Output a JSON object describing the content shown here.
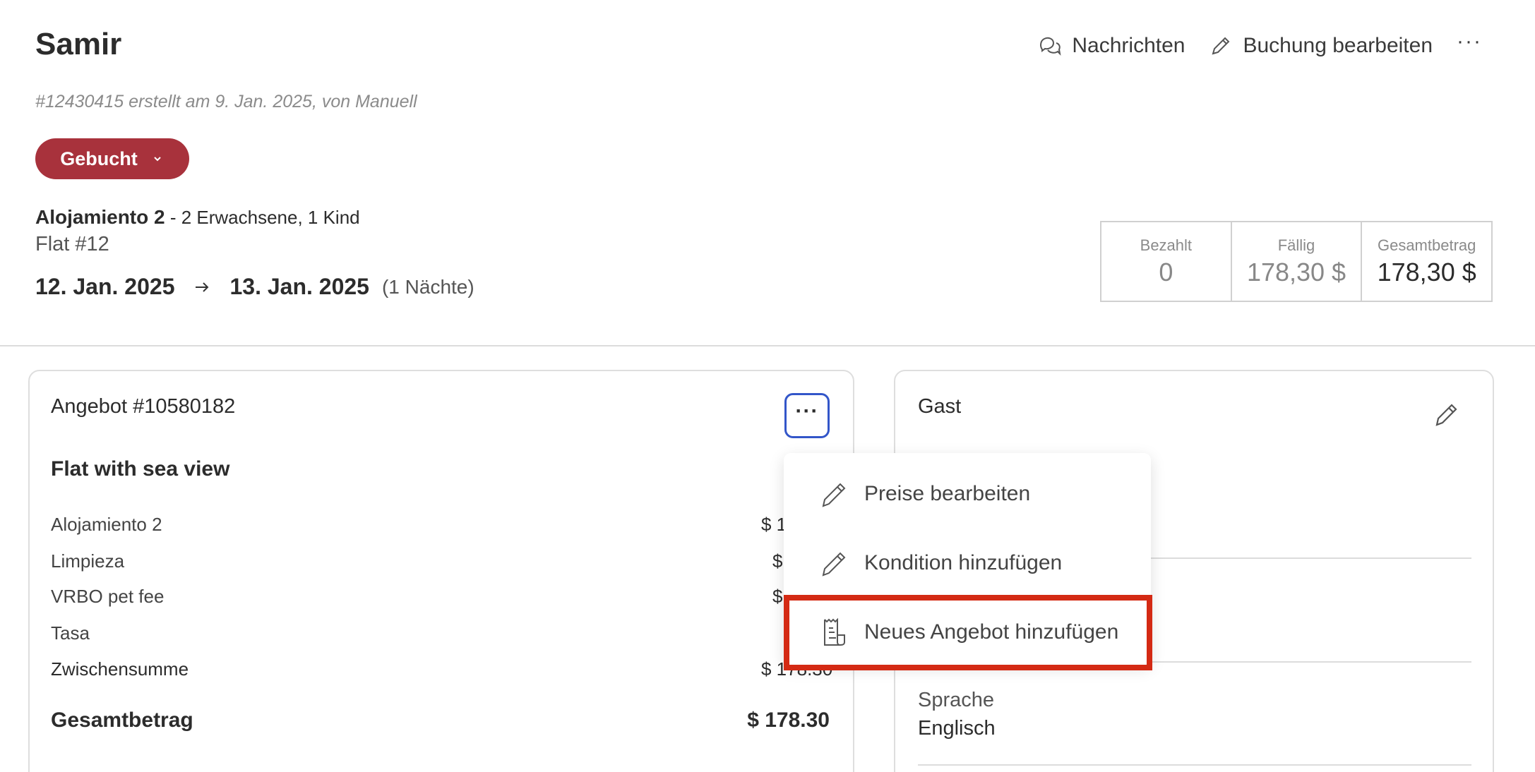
{
  "header": {
    "title": "Samir",
    "actions": {
      "messages_label": "Nachrichten",
      "edit_booking_label": "Buchung bearbeiten",
      "more_label": "···"
    },
    "meta": "#12430415 erstellt am 9. Jan. 2025, von Manuell"
  },
  "status": {
    "label": "Gebucht",
    "color": "#a8323c"
  },
  "booking": {
    "unit": "Alojamiento 2",
    "guests": " - 2 Erwachsene, 1 Kind",
    "flat": "Flat #12",
    "check_in": "12. Jan. 2025",
    "check_out": "13. Jan. 2025",
    "nights": "(1 Nächte)"
  },
  "summary": {
    "paid_label": "Bezahlt",
    "paid_value": "0",
    "due_label": "Fällig",
    "due_value": "178,30 $",
    "total_label": "Gesamtbetrag",
    "total_value": "178,30 $"
  },
  "offer": {
    "title": "Angebot #10580182",
    "more_label": "···",
    "name": "Flat with sea view",
    "lines": [
      {
        "label": "Alojamiento 2",
        "value": "$ 1"
      },
      {
        "label": "Limpieza",
        "value": "$"
      },
      {
        "label": "VRBO pet fee",
        "value": "$"
      },
      {
        "label": "Tasa",
        "value": ""
      },
      {
        "label": "Zwischensumme",
        "value": "$ 178.30"
      }
    ],
    "total_label": "Gesamtbetrag",
    "total_value": "$ 178.30"
  },
  "menu": {
    "items": [
      {
        "label": "Preise bearbeiten",
        "icon": "pencil-icon"
      },
      {
        "label": "Kondition hinzufügen",
        "icon": "pencil-icon"
      },
      {
        "label": "Neues Angebot hinzufügen",
        "icon": "receipt-icon"
      }
    ],
    "highlight_color": "#d42a14"
  },
  "guest": {
    "title": "Gast",
    "language_label": "Sprache",
    "language_value": "Englisch"
  }
}
